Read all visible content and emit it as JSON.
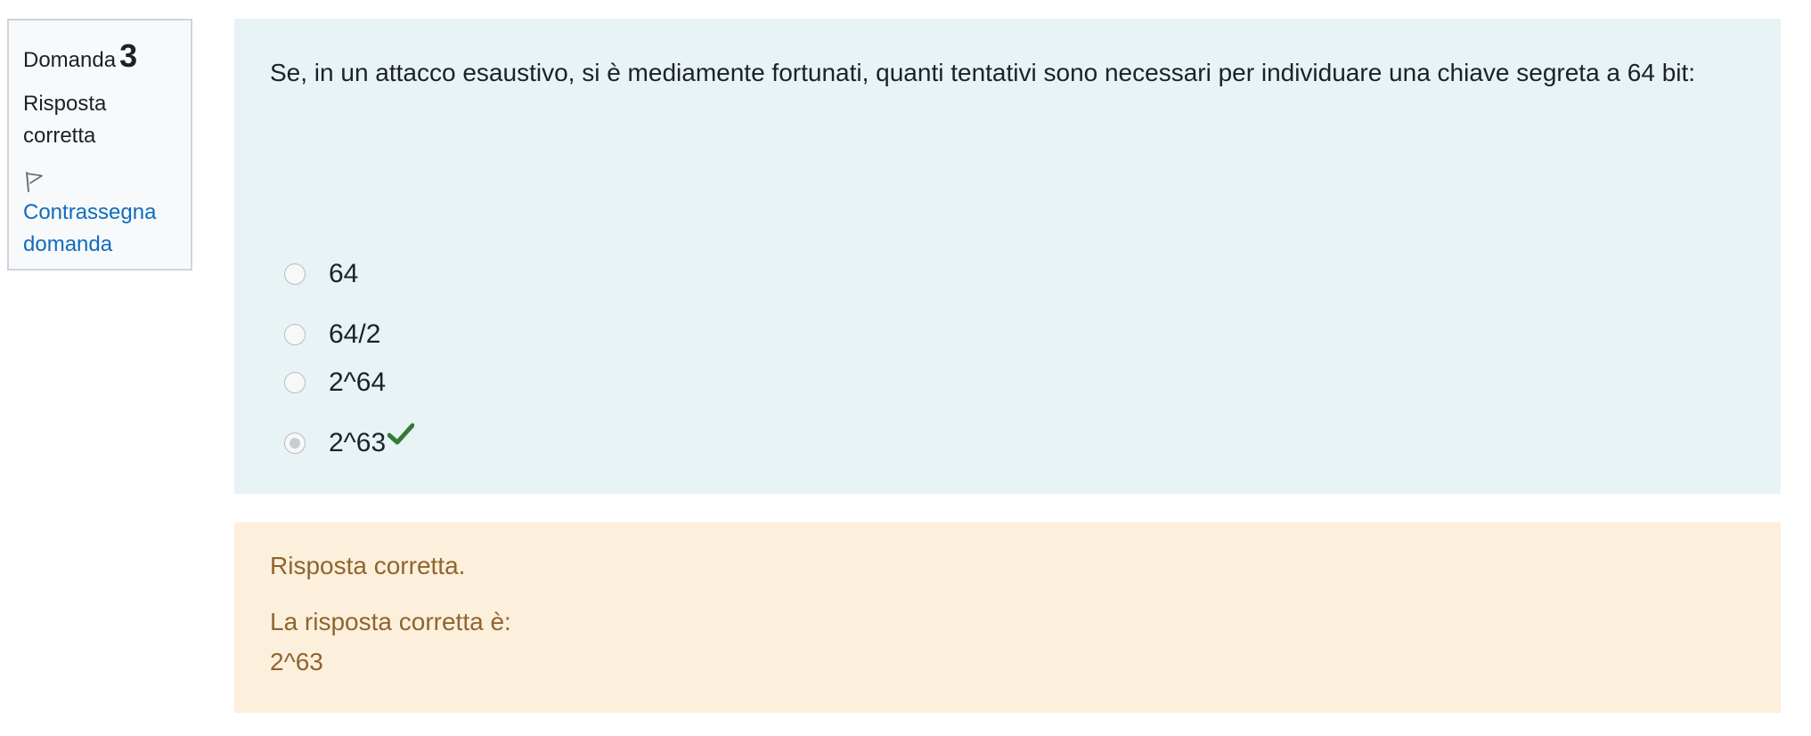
{
  "info": {
    "question_label": "Domanda",
    "question_number": "3",
    "state": "Risposta corretta",
    "flag_icon": "flag-outline-icon",
    "flag_link": "Contrassegna domanda"
  },
  "question": {
    "text": "Se, in un attacco esaustivo, si è mediamente fortunati, quanti tentativi sono necessari per individuare una chiave segreta a 64 bit:",
    "answers": [
      {
        "label": "64",
        "selected": false
      },
      {
        "label": "64/2",
        "selected": false
      },
      {
        "label": "2^64",
        "selected": false
      },
      {
        "label": "2^63",
        "selected": true,
        "correct_icon": "checkmark-icon"
      }
    ]
  },
  "feedback": {
    "general": "Risposta corretta.",
    "right_answer_prefix": "La risposta corretta è:",
    "right_answer_value": "2^63"
  },
  "colors": {
    "question_bg": "#e7f3f5",
    "feedback_bg": "#fcefdc",
    "feedback_text": "#8e662e",
    "link": "#0f6cbf",
    "correct": "#357a32"
  }
}
